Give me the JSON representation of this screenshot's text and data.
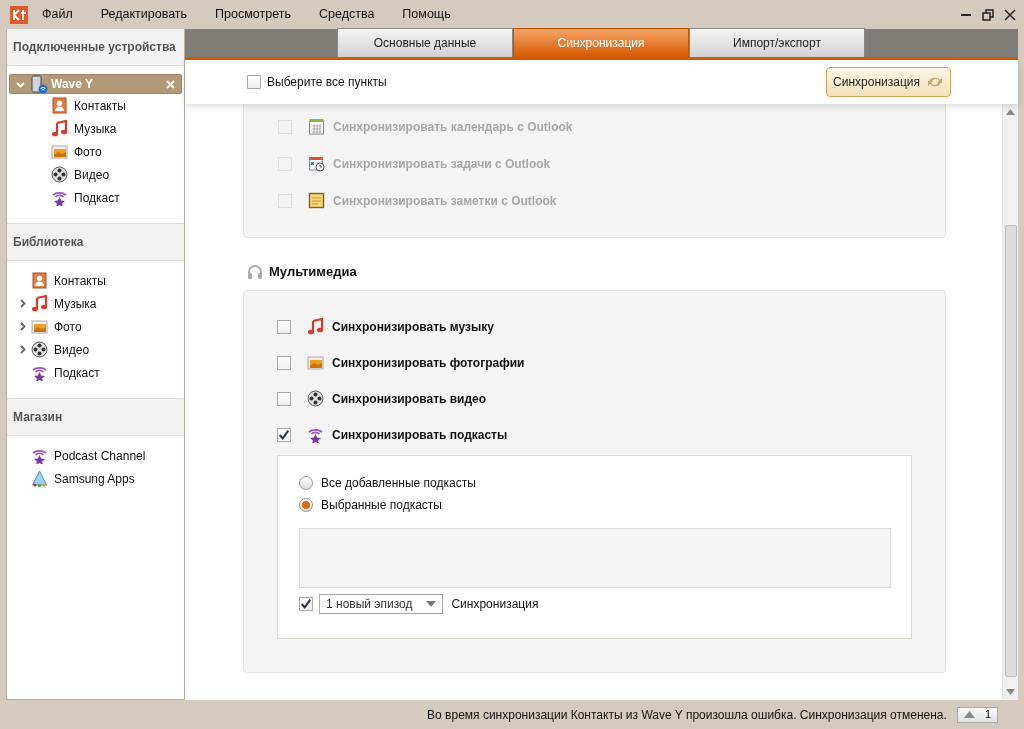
{
  "menu": [
    "Файл",
    "Редактировать",
    "Просмотреть",
    "Средства",
    "Помощь"
  ],
  "sidebar": {
    "sections": [
      {
        "title": "Подключенные устройства",
        "device": {
          "name": "Wave Y",
          "expanded": true,
          "selected": true,
          "children": [
            {
              "label": "Контакты",
              "kind": "contacts"
            },
            {
              "label": "Музыка",
              "kind": "music"
            },
            {
              "label": "Фото",
              "kind": "photo"
            },
            {
              "label": "Видео",
              "kind": "video"
            },
            {
              "label": "Подкаст",
              "kind": "podcast"
            }
          ]
        }
      },
      {
        "title": "Библиотека",
        "items": [
          {
            "label": "Контакты",
            "kind": "contacts",
            "expandable": false
          },
          {
            "label": "Музыка",
            "kind": "music",
            "expandable": true
          },
          {
            "label": "Фото",
            "kind": "photo",
            "expandable": true
          },
          {
            "label": "Видео",
            "kind": "video",
            "expandable": true
          },
          {
            "label": "Подкаст",
            "kind": "podcast",
            "expandable": false
          }
        ]
      },
      {
        "title": "Магазин",
        "items": [
          {
            "label": "Podcast Channel",
            "kind": "podcast",
            "expandable": false
          },
          {
            "label": "Samsung Apps",
            "kind": "apps",
            "expandable": false
          }
        ]
      }
    ]
  },
  "tabs": [
    {
      "label": "Основные данные",
      "selected": false
    },
    {
      "label": "Синхронизация",
      "selected": true
    },
    {
      "label": "Импорт/экспорт",
      "selected": false
    }
  ],
  "toolbar": {
    "select_all": {
      "label": "Выберите все пункты",
      "checked": false
    },
    "sync_button": "Синхронизация"
  },
  "outlook_rows": [
    {
      "label": "Синхронизировать календарь с Outlook",
      "kind": "calendar",
      "checked": false,
      "disabled": true
    },
    {
      "label": "Синхронизировать задачи с Outlook",
      "kind": "tasks",
      "checked": false,
      "disabled": true
    },
    {
      "label": "Синхронизировать заметки с Outlook",
      "kind": "notes",
      "checked": false,
      "disabled": true
    }
  ],
  "multimedia": {
    "title": "Мультимедиа",
    "rows": [
      {
        "label": "Синхронизировать музыку",
        "kind": "music",
        "checked": false,
        "disabled": false
      },
      {
        "label": "Синхронизировать фотографии",
        "kind": "photo",
        "checked": false,
        "disabled": false
      },
      {
        "label": "Синхронизировать видео",
        "kind": "video",
        "checked": false,
        "disabled": false
      },
      {
        "label": "Синхронизировать подкасты",
        "kind": "podcast",
        "checked": true,
        "disabled": false
      }
    ],
    "podcast_options": {
      "radios": [
        {
          "label": "Все добавленные подкасты",
          "selected": false
        },
        {
          "label": "Выбранные подкасты",
          "selected": true
        }
      ],
      "episodes": {
        "checked": true,
        "value": "1 новый эпизод",
        "label": "Синхронизация"
      }
    }
  },
  "status_bar": {
    "message": "Во время синхронизации Контакты из Wave Y произошла ошибка. Синхронизация отменена.",
    "count": "1"
  }
}
